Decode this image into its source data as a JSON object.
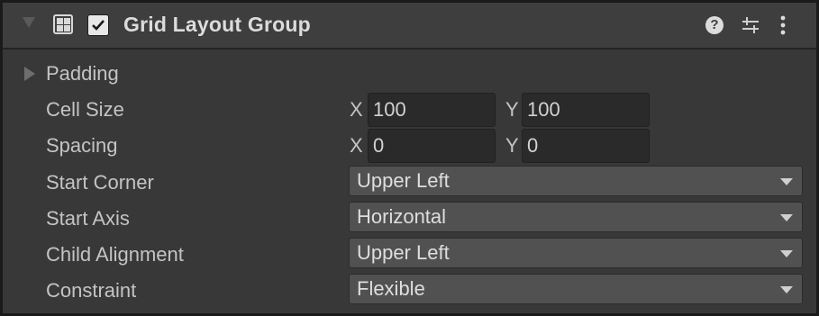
{
  "header": {
    "title": "Grid Layout Group",
    "enabled": true,
    "expanded": true,
    "icons": [
      "foldout-arrow",
      "grid-layout-component-icon",
      "checkmark",
      "help-icon",
      "presets-icon",
      "kebab-menu-icon"
    ]
  },
  "properties": {
    "padding": {
      "label": "Padding",
      "expanded": false
    },
    "cell_size": {
      "label": "Cell Size",
      "x_axis": "X",
      "x_value": "100",
      "y_axis": "Y",
      "y_value": "100"
    },
    "spacing": {
      "label": "Spacing",
      "x_axis": "X",
      "x_value": "0",
      "y_axis": "Y",
      "y_value": "0"
    },
    "start_corner": {
      "label": "Start Corner",
      "value": "Upper Left"
    },
    "start_axis": {
      "label": "Start Axis",
      "value": "Horizontal"
    },
    "child_alignment": {
      "label": "Child Alignment",
      "value": "Upper Left"
    },
    "constraint": {
      "label": "Constraint",
      "value": "Flexible"
    }
  },
  "colors": {
    "panel_bg": "#383838",
    "header_bg": "#3e3e3e",
    "field_bg": "#2a2a2a",
    "dropdown_bg": "#515151",
    "text": "#c4c4c4"
  }
}
